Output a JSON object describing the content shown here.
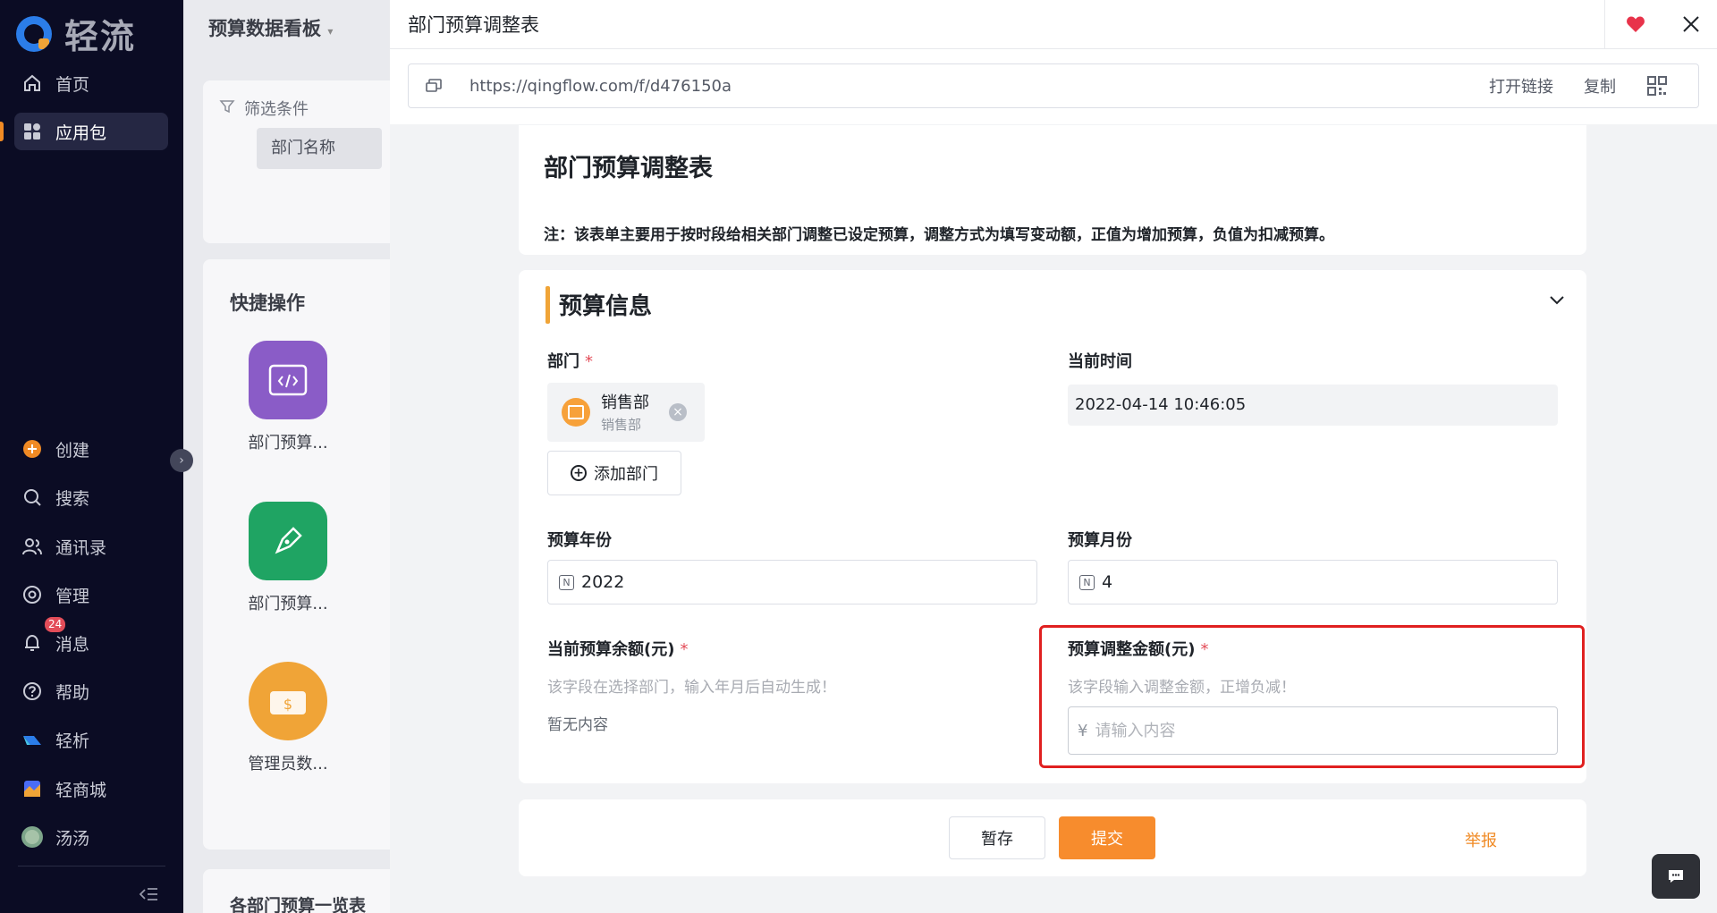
{
  "sidebar": {
    "brand": "轻流",
    "top_items": [
      {
        "label": "首页",
        "icon": "home-icon"
      },
      {
        "label": "应用包",
        "icon": "apps-icon",
        "active": true
      }
    ],
    "bottom_items": [
      {
        "label": "创建",
        "icon": "plus-circle-icon"
      },
      {
        "label": "搜索",
        "icon": "search-icon"
      },
      {
        "label": "通讯录",
        "icon": "contacts-icon"
      },
      {
        "label": "管理",
        "icon": "settings-icon"
      },
      {
        "label": "消息",
        "icon": "bell-icon"
      },
      {
        "label": "帮助",
        "icon": "help-icon"
      },
      {
        "label": "轻析",
        "icon": "analytics-icon"
      },
      {
        "label": "轻商城",
        "icon": "store-icon"
      },
      {
        "label": "汤汤",
        "icon": "user-avatar"
      }
    ],
    "message_badge": "24"
  },
  "background_page": {
    "title": "预算数据看板",
    "filter_label": "筛选条件",
    "filter_chip": "部门名称",
    "quick_ops_title": "快捷操作",
    "apps": [
      {
        "name": "部门预算...",
        "color": "#8a5cc7"
      },
      {
        "name": "部门预算...",
        "color": "#1fa463"
      },
      {
        "name": "管理员数...",
        "color": "#f0a437"
      }
    ],
    "bottom_title": "各部门预算一览表"
  },
  "drawer": {
    "title": "部门预算调整表",
    "link_url": "https://qingflow.com/f/d476150a",
    "open_link": "打开链接",
    "copy": "复制"
  },
  "form": {
    "title": "部门预算调整表",
    "note": "注：该表单主要用于按时段给相关部门调整已设定预算，调整方式为填写变动额，正值为增加预算，负值为扣减预算。",
    "section_title": "预算信息",
    "dept_label": "部门",
    "dept_name": "销售部",
    "dept_sub": "销售部",
    "add_dept": "添加部门",
    "time_label": "当前时间",
    "time_value": "2022-04-14 10:46:05",
    "year_label": "预算年份",
    "year_value": "2022",
    "month_label": "预算月份",
    "month_value": "4",
    "balance_label": "当前预算余额(元)",
    "balance_hint": "该字段在选择部门，输入年月后自动生成！",
    "balance_empty": "暂无内容",
    "adjust_label": "预算调整金额(元)",
    "adjust_hint": "该字段输入调整金额，正增负减！",
    "adjust_placeholder": "请输入内容",
    "currency": "¥",
    "required_mark": "*"
  },
  "footer": {
    "save": "暂存",
    "submit": "提交",
    "report": "举报"
  },
  "colors": {
    "accent": "#f78c2d",
    "sidebar_bg": "#0b0c24",
    "required": "#e34d59",
    "highlight": "#e02020"
  }
}
